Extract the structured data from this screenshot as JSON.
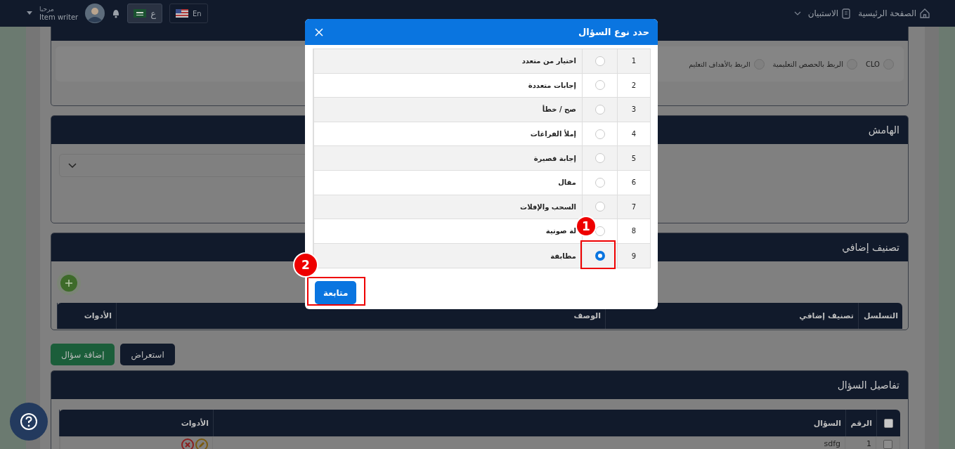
{
  "top_bar": {
    "nav": [
      {
        "label": "الصفحة الرئيسية",
        "kind": "home"
      },
      {
        "label": "الاستبيان",
        "kind": "menu"
      }
    ],
    "user": {
      "greeting": "مرحبا",
      "role": "Item writer"
    },
    "languages": [
      {
        "label": "En",
        "kind": "us",
        "selected": false
      },
      {
        "label": "ع",
        "kind": "sa",
        "selected": true
      }
    ]
  },
  "linking_card": {
    "options": [
      {
        "label": "CLO",
        "selected": false
      },
      {
        "label": "الربط بالحصص التعليمية",
        "selected": false
      },
      {
        "label": "الربط بالأهداف التعليم",
        "selected": false
      }
    ]
  },
  "margin_card": {
    "title": "الهامش"
  },
  "extra_card": {
    "title": "تصنيف إضافي",
    "columns": [
      "التسلسل",
      "تصنيف إضافي",
      "الوصف",
      "الأدوات"
    ]
  },
  "actions": [
    {
      "label": "استعراض",
      "kind": "primary"
    },
    {
      "label": "إضافة سؤال",
      "kind": "success"
    }
  ],
  "details_card": {
    "title": "تفاصيل السؤال",
    "columns": [
      "الرقم",
      "السؤال",
      "الأدوات"
    ],
    "select_all": {
      "checked": false
    },
    "rows": [
      {
        "checked": false,
        "number": "1",
        "question": "sdfg"
      }
    ]
  },
  "dialog": {
    "title": "حدد نوع السؤال",
    "types": [
      {
        "number": "1",
        "label": "اختيار من متعدد",
        "selected": false
      },
      {
        "number": "2",
        "label": "إجابات متعددة",
        "selected": false
      },
      {
        "number": "3",
        "label": "صح / خطأ",
        "selected": false
      },
      {
        "number": "4",
        "label": "إملأ الفراغات",
        "selected": false
      },
      {
        "number": "5",
        "label": "إجابة قصيرة",
        "selected": false
      },
      {
        "number": "6",
        "label": "مقال",
        "selected": false
      },
      {
        "number": "7",
        "label": "السحب والإفلات",
        "selected": false
      },
      {
        "number": "8",
        "label": "لة صوتية",
        "selected": false
      },
      {
        "number": "9",
        "label": "مطابقة",
        "selected": true
      }
    ],
    "continue_button": "متابعة"
  },
  "annotations": [
    {
      "number": "1"
    },
    {
      "number": "2"
    }
  ]
}
